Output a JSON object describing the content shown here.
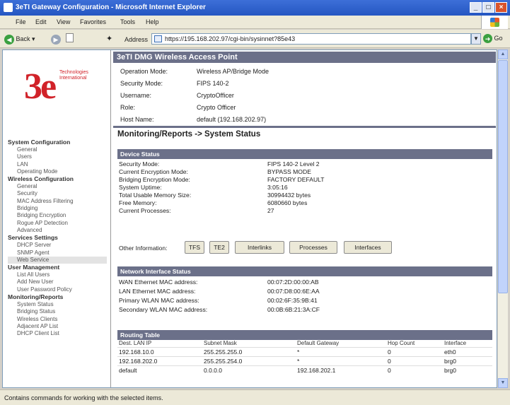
{
  "window": {
    "title": "3eTI Gateway Configuration - Microsoft Internet Explorer",
    "controls": [
      "_",
      "□",
      "×"
    ]
  },
  "menu": [
    "File",
    "Edit",
    "View",
    "Favorites",
    "Tools",
    "Help"
  ],
  "toolbar": {
    "back_label": "Back",
    "address_label": "Address",
    "url": "https://195.168.202.97/cgi-bin/sysinnet?85e43",
    "go_label": "Go"
  },
  "status_bar": "Contains commands for working with the selected items.",
  "logo": {
    "mark": "3e",
    "tagline_line1": "Technologies",
    "tagline_line2": "International"
  },
  "sidebar": [
    {
      "section": "System Configuration",
      "items": [
        "General",
        "Users",
        "LAN",
        "Operating Mode"
      ]
    },
    {
      "section": "Wireless Configuration",
      "items": [
        "General",
        "Security",
        "MAC Address Filtering",
        "Bridging",
        "Bridging Encryption",
        "Rogue AP Detection",
        "Advanced"
      ]
    },
    {
      "section": "Services Settings",
      "items": [
        "DHCP Server",
        "SNMP Agent",
        "Web Service"
      ]
    },
    {
      "section": "User Management",
      "items": [
        "List All Users",
        "Add New User",
        "User Password Policy"
      ]
    },
    {
      "section": "Monitoring/Reports",
      "items": [
        "System Status",
        "Bridging Status",
        "Wireless Clients",
        "Adjacent AP List",
        "DHCP Client List"
      ]
    }
  ],
  "banner": "3eTI DMG Wireless Access Point",
  "device_info": [
    {
      "label": "Operation Mode:",
      "value": "Wireless AP/Bridge Mode"
    },
    {
      "label": "Security Mode:",
      "value": "FIPS 140-2"
    },
    {
      "label": "Username:",
      "value": "CryptoOfficer"
    },
    {
      "label": "Role:",
      "value": "Crypto Officer"
    },
    {
      "label": "Host Name:",
      "value": "default (192.168.202.97)"
    }
  ],
  "page_heading": "Monitoring/Reports -> System Status",
  "device_status": {
    "title": "Device Status",
    "rows": [
      {
        "label": "Security Mode:",
        "value": "FIPS 140-2 Level 2"
      },
      {
        "label": "Current Encryption Mode:",
        "value": "BYPASS MODE"
      },
      {
        "label": "Bridging Encryption Mode:",
        "value": "FACTORY DEFAULT"
      },
      {
        "label": "System Uptime:",
        "value": "3:05:16"
      },
      {
        "label": "Total Usable Memory Size:",
        "value": "30994432 bytes"
      },
      {
        "label": "Free Memory:",
        "value": "6080660 bytes"
      },
      {
        "label": "Current Processes:",
        "value": "27"
      }
    ]
  },
  "other_info": {
    "label": "Other Information:",
    "buttons": [
      "TFS",
      "TE2",
      "Interlinks",
      "Processes",
      "Interfaces"
    ]
  },
  "network_status": {
    "title": "Network Interface Status",
    "rows": [
      {
        "label": "WAN Ethernet MAC address:",
        "value": "00:07:2D:00:00:AB"
      },
      {
        "label": "LAN Ethernet MAC address:",
        "value": "00:07:D8:00:6E:AA"
      },
      {
        "label": "Primary WLAN MAC address:",
        "value": "00:02:6F:35:9B:41"
      },
      {
        "label": "Secondary WLAN MAC address:",
        "value": "00:0B:6B:21:3A:CF"
      }
    ]
  },
  "routing_table": {
    "title": "Routing Table",
    "columns": [
      "Dest. LAN IP",
      "Subnet Mask",
      "Default Gateway",
      "Hop Count",
      "Interface"
    ],
    "rows": [
      [
        "192.168.10.0",
        "255.255.255.0",
        "*",
        "0",
        "eth0"
      ],
      [
        "192.168.202.0",
        "255.255.254.0",
        "*",
        "0",
        "brg0"
      ],
      [
        "default",
        "0.0.0.0",
        "192.168.202.1",
        "0",
        "brg0"
      ]
    ]
  }
}
